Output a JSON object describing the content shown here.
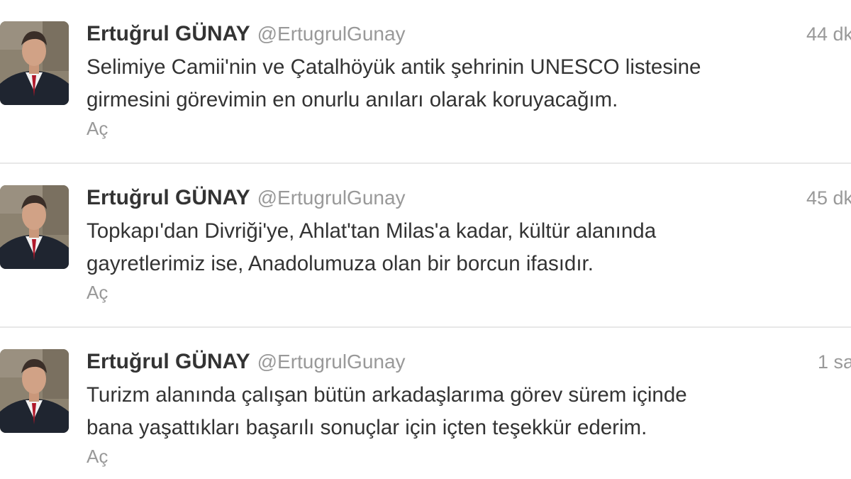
{
  "tweets": [
    {
      "fullname": "Ertuğrul GÜNAY",
      "username": "@ErtugrulGunay",
      "timestamp": "44 dk",
      "lines": [
        "Selimiye Camii'nin ve Çatalhöyük antik şehrinin UNESCO listesine",
        "girmesini görevimin en onurlu anıları olarak koruyacağım."
      ],
      "expand": "Aç"
    },
    {
      "fullname": "Ertuğrul GÜNAY",
      "username": "@ErtugrulGunay",
      "timestamp": "45 dk",
      "lines": [
        "Topkapı'dan Divriği'ye, Ahlat'tan Milas'a kadar, kültür alanında",
        "gayretlerimiz ise, Anadolumuza olan bir borcun ifasıdır."
      ],
      "expand": "Aç"
    },
    {
      "fullname": "Ertuğrul GÜNAY",
      "username": "@ErtugrulGunay",
      "timestamp": "1 sa",
      "lines": [
        "Turizm alanında çalışan bütün arkadaşlarıma görev sürem içinde",
        "bana yaşattıkları başarılı sonuçlar için içten teşekkür ederim."
      ],
      "expand": "Aç"
    }
  ],
  "colors": {
    "name": "#333333",
    "meta": "#999999",
    "divider": "#e8e8e8"
  },
  "icons": {
    "avatar": "profile-photo-man-in-suit"
  }
}
